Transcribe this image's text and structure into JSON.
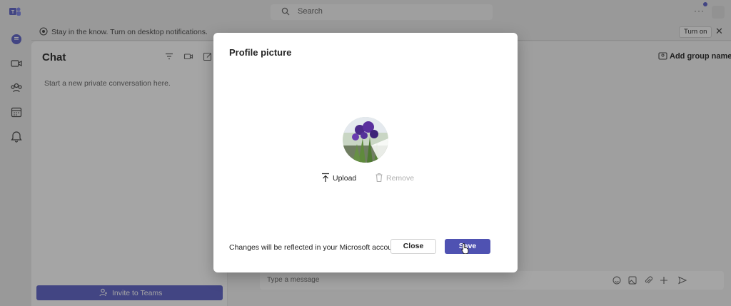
{
  "header": {
    "search_placeholder": "Search",
    "more_label": "···"
  },
  "banner": {
    "text": "Stay in the know. Turn on desktop notifications.",
    "turn_on_label": "Turn on",
    "close_label": "✕"
  },
  "chat": {
    "title": "Chat",
    "empty_text": "Start a new private conversation here.",
    "invite_label": "Invite to Teams"
  },
  "main": {
    "add_group_label": "Add group name",
    "compose_placeholder": "Type a message"
  },
  "dialog": {
    "title": "Profile picture",
    "upload_label": "Upload",
    "remove_label": "Remove",
    "note": "Changes will be reflected in your Microsoft account.",
    "close_label": "Close",
    "save_label": "Save"
  },
  "colors": {
    "brand": "#5b5fc7",
    "save_button": "#4f52b2",
    "overlay": "rgba(30,30,30,0.40)"
  },
  "icons": {
    "rail": [
      "chat-icon",
      "video-icon",
      "communities-icon",
      "calendar-icon",
      "activity-icon"
    ],
    "chat_tools": [
      "filter-icon",
      "meet-now-icon",
      "new-chat-icon"
    ],
    "compose_tools": [
      "emoji-icon",
      "image-icon",
      "attach-icon",
      "plus-icon",
      "send-icon"
    ]
  }
}
